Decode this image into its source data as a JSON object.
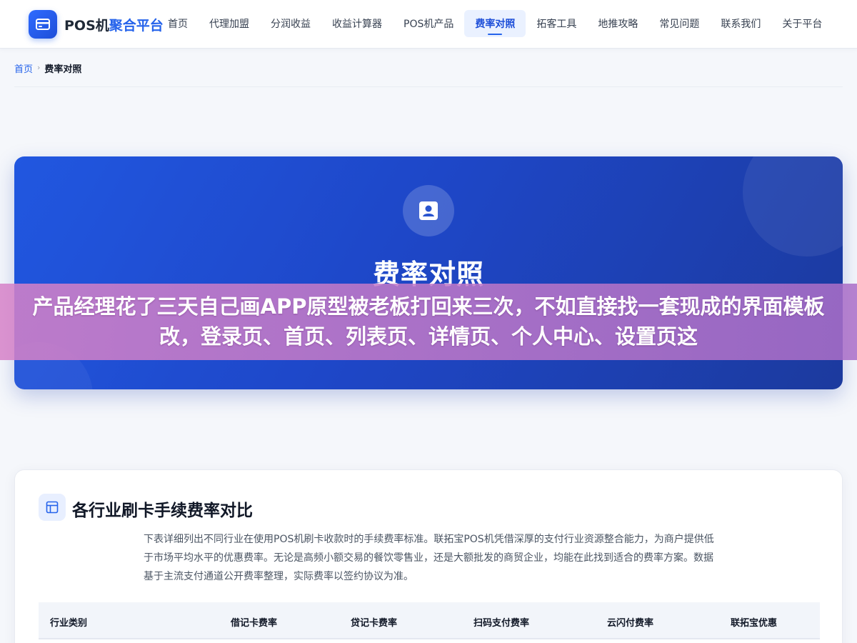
{
  "brand": {
    "name_prefix": "POS机",
    "name_highlight": "聚合平台",
    "icon": "card-icon"
  },
  "nav": {
    "items": [
      {
        "label": "首页",
        "active": false
      },
      {
        "label": "代理加盟",
        "active": false
      },
      {
        "label": "分润收益",
        "active": false
      },
      {
        "label": "收益计算器",
        "active": false
      },
      {
        "label": "POS机产品",
        "active": false
      },
      {
        "label": "费率对照",
        "active": true
      },
      {
        "label": "拓客工具",
        "active": false
      },
      {
        "label": "地推攻略",
        "active": false
      },
      {
        "label": "常见问题",
        "active": false
      },
      {
        "label": "联系我们",
        "active": false
      },
      {
        "label": "关于平台",
        "active": false
      }
    ]
  },
  "breadcrumb": {
    "home": "首页",
    "separator": "›",
    "current": "费率对照"
  },
  "hero": {
    "icon": "user-badge-icon",
    "title": "费率对照"
  },
  "overlay": {
    "text": "产品经理花了三天自己画APP原型被老板打回来三次，不如直接找一套现成的界面模板改，登录页、首页、列表页、详情页、个人中心、设置页这"
  },
  "section": {
    "icon": "table-icon",
    "title": "各行业刷卡手续费率对比",
    "description": "下表详细列出不同行业在使用POS机刷卡收款时的手续费率标准。联拓宝POS机凭借深厚的支付行业资源整合能力，为商户提供低于市场平均水平的优惠费率。无论是高频小额交易的餐饮零售业，还是大额批发的商贸企业，均能在此找到适合的费率方案。数据基于主流支付通道公开费率整理，实际费率以签约协议为准。",
    "table": {
      "columns": [
        "行业类别",
        "借记卡费率",
        "贷记卡费率",
        "扫码支付费率",
        "云闪付费率",
        "联拓宝优惠"
      ]
    }
  },
  "colors": {
    "primary": "#2563eb",
    "hero_start": "#2157e0",
    "hero_end": "#1c3a9e",
    "overlay": "#d682c8"
  }
}
